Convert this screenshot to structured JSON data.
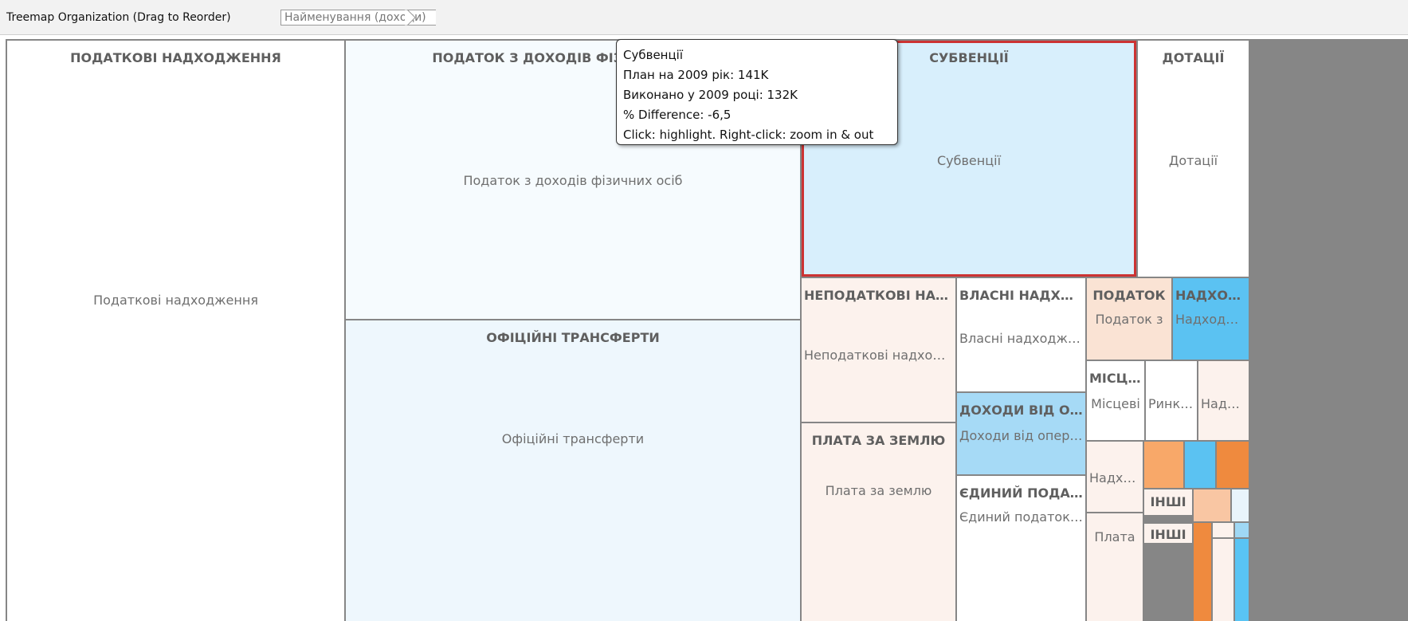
{
  "toolbar": {
    "organization_label": "Treemap Organization (Drag to Reorder)",
    "breadcrumb": "Найменування (доходи)"
  },
  "colors": {
    "white": "#ffffff",
    "pale_blue": "#eef7fd",
    "light_blue": "#d3eefc",
    "blue": "#59c4f4",
    "mid_blue": "#9fd8f5",
    "pale_peach": "#fcf2ed",
    "peach": "#f9ddcc",
    "orange": "#f7a466",
    "dark_orange": "#ef8a3e",
    "selected_border": "#cc3333"
  },
  "cells": [
    {
      "id": "podatkovi",
      "header": "ПОДАТКОВІ НАДХОДЖЕННЯ",
      "sub": "Податкові надходження",
      "color": "#ffffff"
    },
    {
      "id": "pdfo",
      "header": "ПОДАТОК З ДОХОДІВ ФІЗИЧНИХ ОСІБ",
      "sub": "Податок з доходів фізичних осіб",
      "color": "#f6fbfe"
    },
    {
      "id": "subventsii",
      "header": "СУБВЕНЦІЇ",
      "sub": "Субвенції",
      "color": "#d8effc",
      "selected": true
    },
    {
      "id": "dotatsii",
      "header": "ДОТАЦІЇ",
      "sub": "Дотації",
      "color": "#ffffff"
    },
    {
      "id": "ofitsiini",
      "header": "ОФІЦІЙНІ ТРАНСФЕРТИ",
      "sub": "Офіційні трансферти",
      "color": "#eef7fd"
    },
    {
      "id": "nepodatkovi",
      "header": "НЕПОДАТКОВІ НАДХОДЖЕННЯ",
      "sub": "Неподаткові надходження",
      "color": "#fcf2ed"
    },
    {
      "id": "plata_zemlyu",
      "header": "ПЛАТА ЗА ЗЕМЛЮ",
      "sub": "Плата за землю",
      "color": "#fcf2ed"
    },
    {
      "id": "vlasni",
      "header": "ВЛАСНІ НАДХОДЖЕННЯ",
      "sub": "Власні надходження",
      "color": "#ffffff"
    },
    {
      "id": "dokhody_operatsii",
      "header": "ДОХОДИ ВІД ОПЕРАЦІЙ",
      "sub": "Доходи від операцій",
      "color": "#a6daf6"
    },
    {
      "id": "yedynyi",
      "header": "ЄДИНИЙ ПОДАТОК",
      "sub": "Єдиний податок для",
      "color": "#ffffff"
    },
    {
      "id": "podatok_small",
      "header": "ПОДАТОК",
      "sub": "Податок з",
      "color": "#fae3d4"
    },
    {
      "id": "nadkhod_blue",
      "header": "НАДХОДЖЕННЯ",
      "sub": "Надходження",
      "color": "#5bc2f2"
    },
    {
      "id": "mists",
      "header": "МІСЦЕВІ",
      "sub": "Місцеві",
      "color": "#ffffff"
    },
    {
      "id": "rynk",
      "header": "",
      "sub": "Ринковий",
      "color": "#ffffff"
    },
    {
      "id": "nadkh_a",
      "header": "",
      "sub": "Надходження",
      "color": "#fcf2ed"
    },
    {
      "id": "nadkh_b",
      "header": "",
      "sub": "Надходження",
      "color": "#fcf2ed"
    },
    {
      "id": "plat_small",
      "header": "",
      "sub": "Плата",
      "color": "#fcf2ed"
    },
    {
      "id": "inshi_a",
      "header": "ІНШІ",
      "sub": "",
      "color": "#fcf2ed"
    },
    {
      "id": "inshi_b",
      "header": "ІНШІ",
      "sub": "",
      "color": "#fcf2ed"
    },
    {
      "id": "tiny_orange_1",
      "header": "",
      "sub": "",
      "color": "#f8a869"
    },
    {
      "id": "tiny_blue_1",
      "header": "",
      "sub": "",
      "color": "#5bc2f2"
    },
    {
      "id": "tiny_orange_2",
      "header": "",
      "sub": "",
      "color": "#ef8a3e"
    },
    {
      "id": "tiny_peach_1",
      "header": "",
      "sub": "",
      "color": "#f9c6a3"
    },
    {
      "id": "tiny_pale_1",
      "header": "",
      "sub": "",
      "color": "#e9f4fb"
    },
    {
      "id": "tiny_orange_3",
      "header": "",
      "sub": "",
      "color": "#ef8a3e"
    },
    {
      "id": "tiny_pale_2",
      "header": "",
      "sub": "",
      "color": "#fcf2ed"
    },
    {
      "id": "tiny_pale_3",
      "header": "",
      "sub": "",
      "color": "#fcf2ed"
    },
    {
      "id": "tiny_blue_2",
      "header": "",
      "sub": "",
      "color": "#9fd8f5"
    },
    {
      "id": "tiny_blue_3",
      "header": "",
      "sub": "",
      "color": "#59c4f4"
    }
  ],
  "tooltip": {
    "name": "Субвенції",
    "plan": "План на 2009 рік: 141K",
    "done": "Виконано у 2009 році: 132K",
    "diff": "% Difference: -6,5",
    "hint": "Click: highlight. Right-click: zoom in & out"
  }
}
